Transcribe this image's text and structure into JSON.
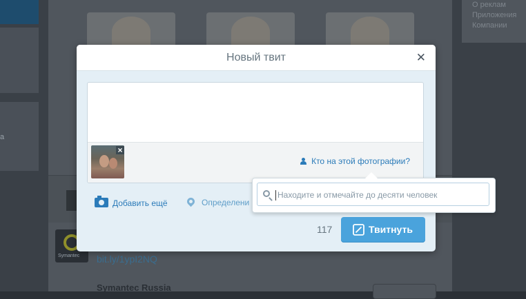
{
  "background": {
    "right_links": [
      "О реклам",
      "Приложения",
      "Компании"
    ],
    "left_text": "а",
    "link": "bit.ly/1ypI2NQ",
    "account_name": "Symantec Russia",
    "logo_text": "Symantec"
  },
  "modal": {
    "title": "Новый твит",
    "close_icon": "close-icon",
    "who_in_photo_label": "Кто на этой фотографии?",
    "add_photo_label": "Добавить ещё",
    "location_label": "Определени",
    "counter": "117",
    "tweet_button_label": "Твитнуть"
  },
  "tag_popup": {
    "placeholder": "Находите и отмечайте до десяти человек"
  },
  "colors": {
    "accent": "#4aa3dc",
    "link": "#2b7bb9",
    "overlay": "#3a4047"
  }
}
